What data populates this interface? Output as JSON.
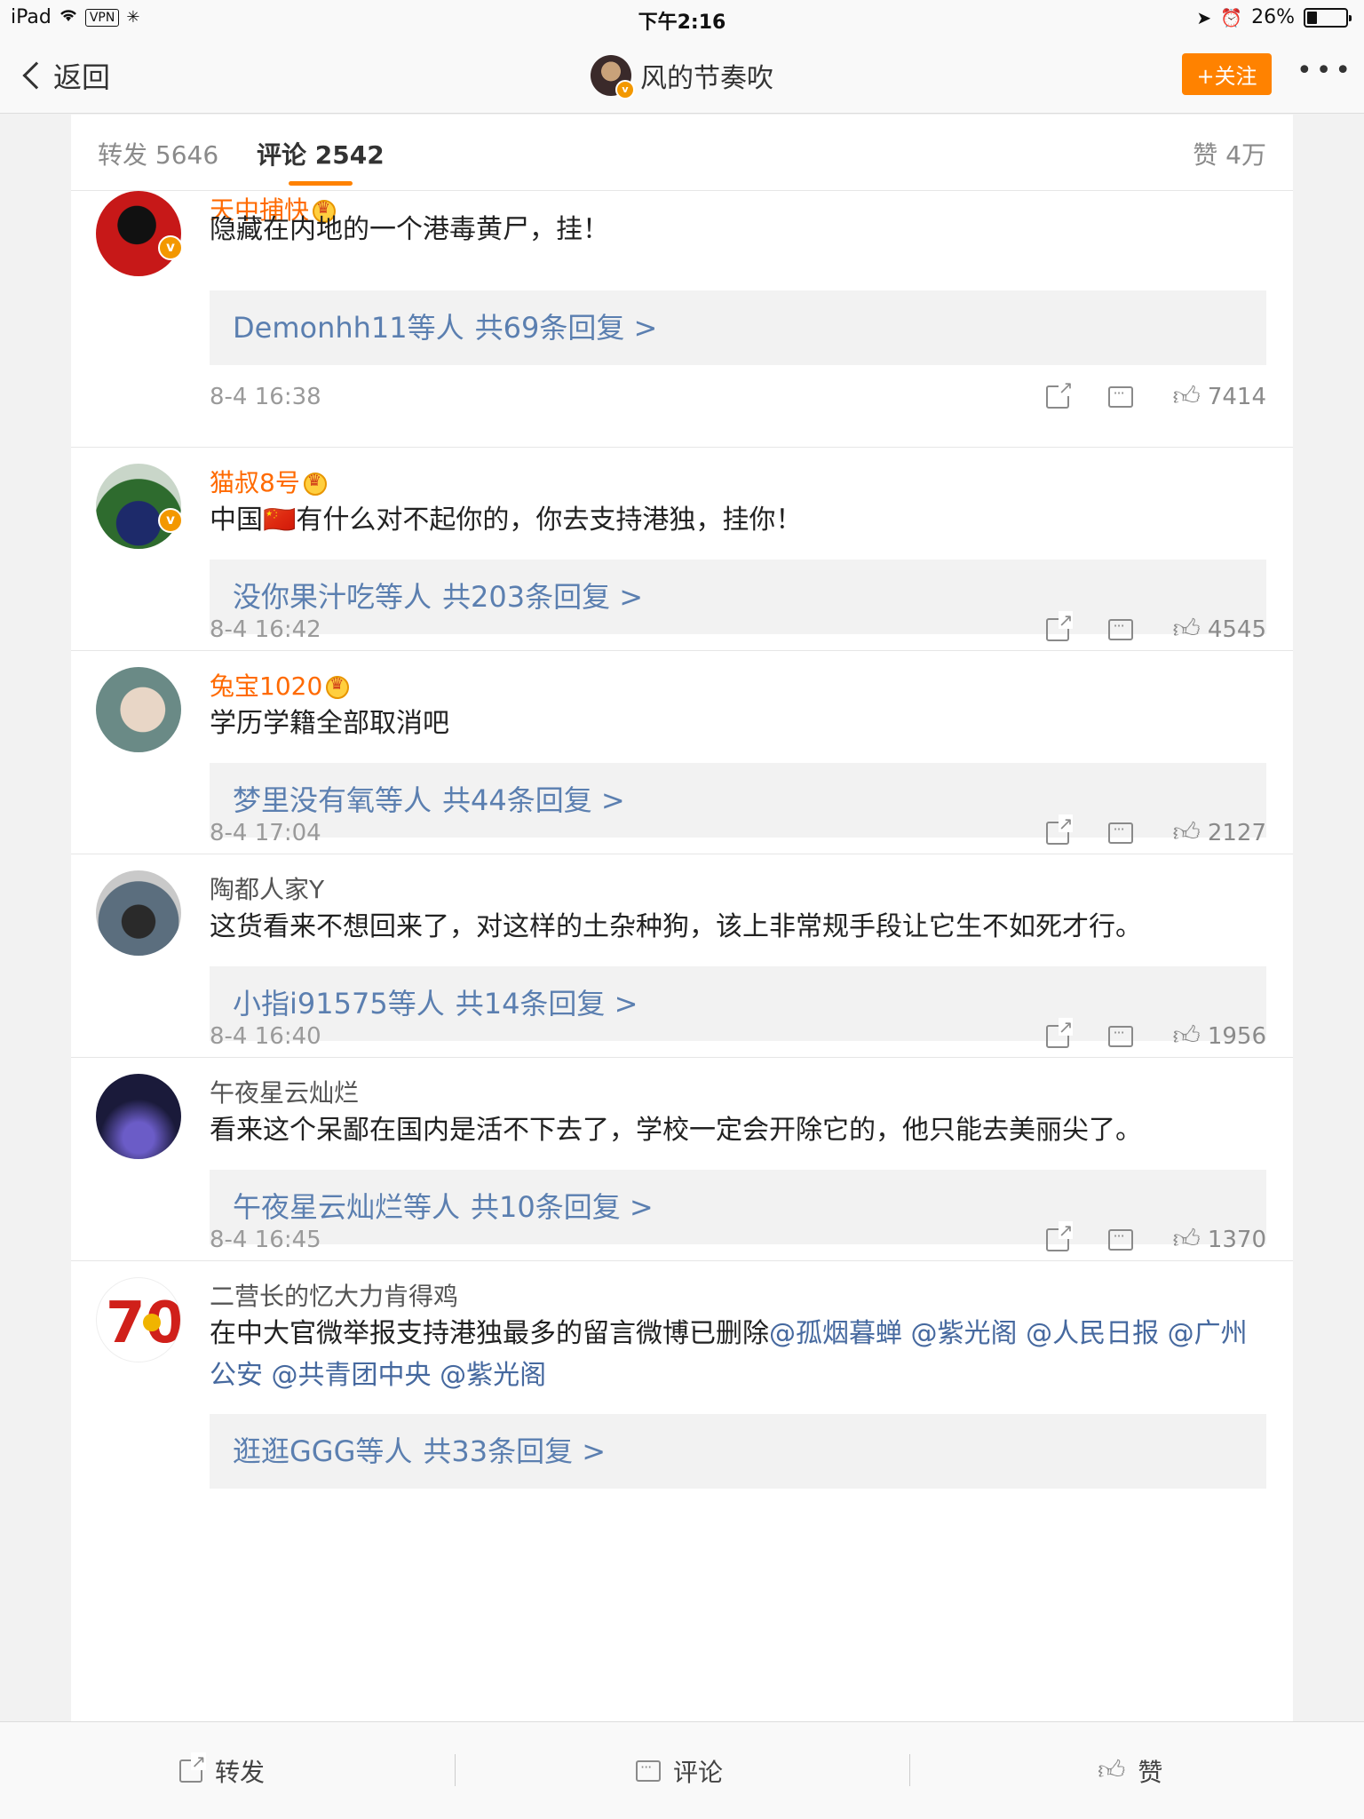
{
  "status_bar": {
    "device": "iPad",
    "vpn": "VPN",
    "time": "下午2:16",
    "battery": "26%",
    "battery_level": 0.26
  },
  "nav": {
    "back_label": "返回",
    "title": "风的节奏吹",
    "follow_label": "+关注",
    "more_label": "•••"
  },
  "tabs": {
    "repost": "转发 5646",
    "comments": "评论 2542",
    "likes": "赞 4万"
  },
  "comments": [
    {
      "user": "天中捕快",
      "text": "隐藏在内地的一个港毒黄尸，挂！",
      "reply_who": "Demonhh11等人",
      "reply_count": "共69条回复 >",
      "time": "8-4 16:38",
      "likes": "7414"
    },
    {
      "user": "猫叔8号",
      "text": "中国🇨🇳有什么对不起你的，你去支持港独，挂你！",
      "reply_who": "没你果汁吃等人",
      "reply_count": "共203条回复 >",
      "time": "8-4 16:42",
      "likes": "4545"
    },
    {
      "user": "兔宝1020",
      "text": "学历学籍全部取消吧",
      "reply_who": "梦里没有氧等人",
      "reply_count": "共44条回复 >",
      "time": "8-4 17:04",
      "likes": "2127"
    },
    {
      "user": "陶都人家Y",
      "text": "这货看来不想回来了，对这样的土杂种狗，该上非常规手段让它生不如死才行。",
      "reply_who": "小指i91575等人",
      "reply_count": "共14条回复 >",
      "time": "8-4 16:40",
      "likes": "1956"
    },
    {
      "user": "午夜星云灿烂",
      "text": "看来这个呆鄙在国内是活不下去了，学校一定会开除它的，他只能去美丽尖了。",
      "reply_who": "午夜星云灿烂等人",
      "reply_count": "共10条回复 >",
      "time": "8-4 16:45",
      "likes": "1370"
    },
    {
      "user": "二营长的忆大力肯得鸡",
      "text_plain": "在中大官微举报支持港独最多的留言微博已删除",
      "mentions": "@孤烟暮蝉 @紫光阁 @人民日报 @广州公安 @共青团中央 @紫光阁",
      "reply_who": "逛逛GGG等人",
      "reply_count": "共33条回复 >"
    }
  ],
  "bottom_bar": {
    "repost": "转发",
    "comment": "评论",
    "like": "赞"
  },
  "colors": {
    "accent_orange": "#ff8200",
    "vip_name": "#ff6a00",
    "link_blue": "#5b7fb0"
  }
}
